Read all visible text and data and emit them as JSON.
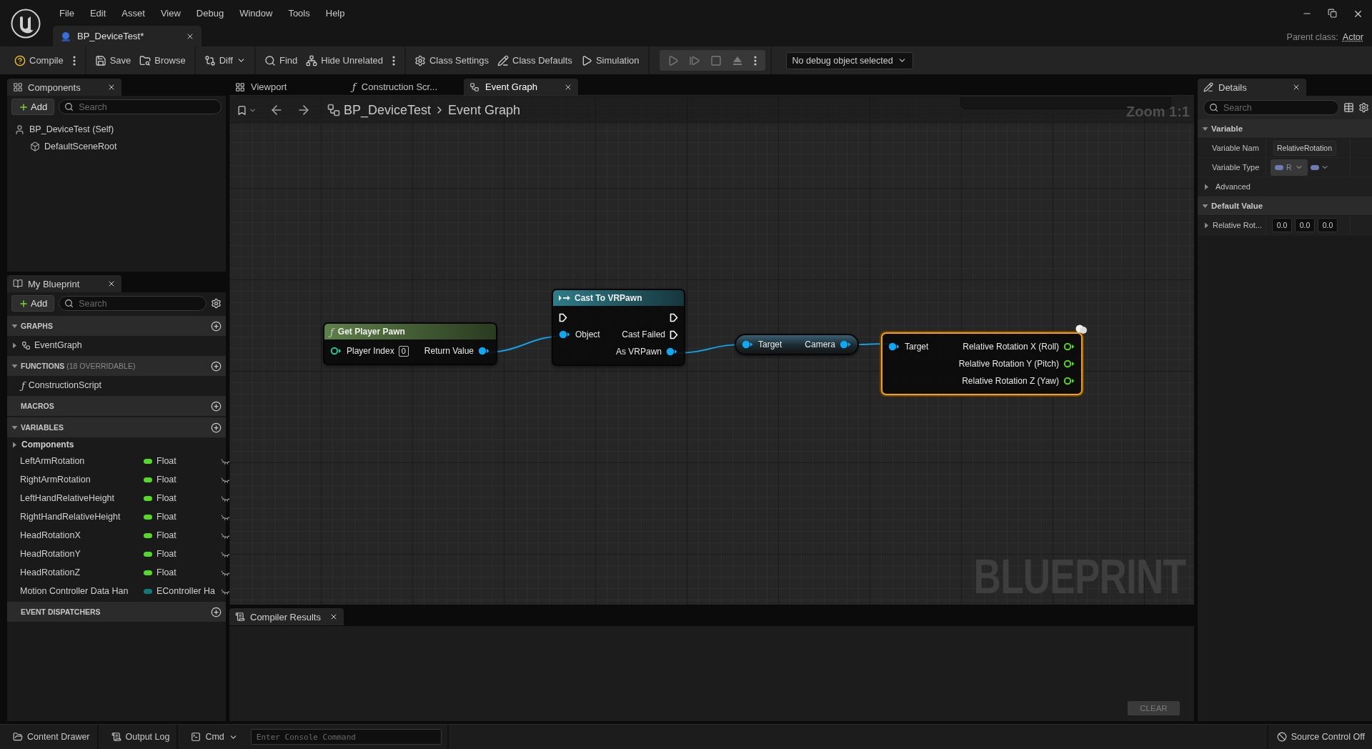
{
  "window": {
    "menu": [
      "File",
      "Edit",
      "Asset",
      "View",
      "Debug",
      "Window",
      "Tools",
      "Help"
    ],
    "document_tab": {
      "title": "BP_DeviceTest*"
    },
    "parent_class_label": "Parent class:",
    "parent_class": "Actor"
  },
  "toolbar": {
    "groups": [
      {
        "kind": "plain",
        "items": [
          {
            "kind": "compile",
            "label": "Compile"
          },
          {
            "kind": "more"
          }
        ]
      },
      {
        "kind": "plain",
        "items": [
          {
            "kind": "save",
            "label": "Save"
          },
          {
            "kind": "browse",
            "label": "Browse"
          }
        ]
      },
      {
        "kind": "plain",
        "items": [
          {
            "kind": "diff",
            "label": "Diff"
          }
        ]
      },
      {
        "kind": "plain",
        "items": [
          {
            "kind": "find",
            "label": "Find"
          },
          {
            "kind": "hide",
            "label": "Hide Unrelated"
          },
          {
            "kind": "more"
          }
        ]
      },
      {
        "kind": "plain",
        "items": [
          {
            "kind": "settings",
            "label": "Class Settings"
          },
          {
            "kind": "defaults",
            "label": "Class Defaults"
          },
          {
            "kind": "simulation",
            "label": "Simulation"
          }
        ]
      },
      {
        "kind": "boxed",
        "items": [
          {
            "kind": "play",
            "disabled": true
          },
          {
            "kind": "step",
            "disabled": true
          },
          {
            "kind": "stop",
            "disabled": true
          },
          {
            "kind": "eject",
            "disabled": true
          },
          {
            "kind": "more",
            "disabled": false
          }
        ]
      }
    ],
    "debug_object": "No debug object selected"
  },
  "components_panel": {
    "title": "Components",
    "add_label": "Add",
    "search_placeholder": "Search",
    "tree": [
      {
        "label": "BP_DeviceTest (Self)",
        "kind": "actor",
        "children": [
          {
            "label": "DefaultSceneRoot",
            "kind": "scene"
          }
        ]
      }
    ]
  },
  "my_blueprint": {
    "title": "My Blueprint",
    "add_label": "Add",
    "search_placeholder": "Search",
    "sections": [
      {
        "title": "GRAPHS",
        "expanded": true,
        "items": [
          {
            "label": "EventGraph",
            "kind": "graph",
            "expanded": false
          }
        ]
      },
      {
        "title": "FUNCTIONS",
        "note": "(18 OVERRIDABLE)",
        "expanded": true,
        "items": [
          {
            "label": "ConstructionScript",
            "kind": "function",
            "glyph": "ƒ"
          }
        ]
      },
      {
        "title": "MACROS"
      },
      {
        "title": "VARIABLES",
        "expanded": true,
        "categories": [
          {
            "label": "Components",
            "expanded": false
          }
        ],
        "variables": [
          {
            "name": "LeftArmRotation",
            "type": "Float",
            "color": "#56d82a"
          },
          {
            "name": "RightArmRotation",
            "type": "Float",
            "color": "#56d82a"
          },
          {
            "name": "LeftHandRelativeHeight",
            "type": "Float",
            "color": "#56d82a"
          },
          {
            "name": "RightHandRelativeHeight",
            "type": "Float",
            "color": "#56d82a"
          },
          {
            "name": "HeadRotationX",
            "type": "Float",
            "color": "#56d82a"
          },
          {
            "name": "HeadRotationY",
            "type": "Float",
            "color": "#56d82a"
          },
          {
            "name": "HeadRotationZ",
            "type": "Float",
            "color": "#56d82a"
          },
          {
            "name": "Motion Controller Data Han",
            "type": "EController Ha",
            "color": "#0f7a78"
          }
        ]
      },
      {
        "title": "EVENT DISPATCHERS"
      }
    ]
  },
  "editor_tabs": [
    {
      "label": "Viewport",
      "kind": "viewport",
      "selected": false
    },
    {
      "label": "Construction Scr...",
      "kind": "function",
      "glyph": "ƒ",
      "selected": false
    },
    {
      "label": "Event Graph",
      "kind": "graph",
      "selected": true
    }
  ],
  "graph": {
    "breadcrumb": [
      "BP_DeviceTest",
      "Event Graph"
    ],
    "zoom": "Zoom 1:1",
    "watermark": "BLUEPRINT",
    "nodes": [
      {
        "kind": "function",
        "glyph": "ƒ",
        "title": "Get Player Pawn",
        "selected": false,
        "inputs": [
          {
            "kind": "data",
            "label": "Player Index",
            "connected": false,
            "color": "#1fc8a0",
            "value": "0"
          }
        ],
        "outputs": [
          {
            "kind": "data",
            "label": "Return Value",
            "connected": true,
            "color": "#10a8f0"
          }
        ]
      },
      {
        "kind": "cast",
        "title": "Cast To VRPawn",
        "selected": false,
        "inputs": [
          {
            "kind": "exec",
            "connected": false
          },
          {
            "kind": "data",
            "label": "Object",
            "connected": true,
            "color": "#10a8f0"
          }
        ],
        "outputs": [
          {
            "kind": "exec",
            "connected": false
          },
          {
            "kind": "exec",
            "label": "Cast Failed",
            "connected": false
          },
          {
            "kind": "data",
            "label": "As VRPawn",
            "connected": true,
            "color": "#10a8f0"
          }
        ]
      },
      {
        "kind": "getter",
        "selected": false,
        "inputs": [
          {
            "kind": "data",
            "label": "Target",
            "connected": true,
            "color": "#10a8f0"
          }
        ],
        "outputs": [
          {
            "kind": "data",
            "label": "Camera",
            "connected": true,
            "color": "#10a8f0"
          }
        ]
      },
      {
        "kind": "break",
        "selected": true,
        "inputs": [
          {
            "kind": "data",
            "label": "Target",
            "connected": true,
            "color": "#10a8f0"
          }
        ],
        "outputs": [
          {
            "kind": "data",
            "label": "Relative Rotation X (Roll)",
            "connected": false,
            "color": "#56d82a"
          },
          {
            "kind": "data",
            "label": "Relative Rotation Y (Pitch)",
            "connected": false,
            "color": "#56d82a"
          },
          {
            "kind": "data",
            "label": "Relative Rotation Z (Yaw)",
            "connected": false,
            "color": "#56d82a"
          }
        ]
      }
    ]
  },
  "compiler_results": {
    "title": "Compiler Results",
    "clear_label": "CLEAR"
  },
  "details": {
    "title": "Details",
    "search_placeholder": "Search",
    "categories": [
      {
        "title": "Variable",
        "expanded": true,
        "rows": [
          {
            "kind": "text",
            "label": "Variable Nam",
            "value": "RelativeRotation"
          },
          {
            "kind": "type",
            "label": "Variable Type",
            "value": "R",
            "color": "#6e7cb4"
          },
          {
            "kind": "group",
            "label": "Advanced",
            "expanded": false
          }
        ]
      },
      {
        "title": "Default Value",
        "expanded": true,
        "rows": [
          {
            "kind": "vector",
            "label": "Relative Rot...",
            "expanded": false,
            "values": [
              "0.0",
              "0.0",
              "0.0"
            ]
          }
        ]
      }
    ]
  },
  "status_bar": {
    "items": [
      {
        "kind": "content",
        "label": "Content Drawer"
      },
      {
        "kind": "log",
        "label": "Output Log"
      },
      {
        "kind": "cmd",
        "label": "Cmd"
      }
    ],
    "console_placeholder": "Enter Console Command",
    "source_control": "Source Control Off"
  }
}
